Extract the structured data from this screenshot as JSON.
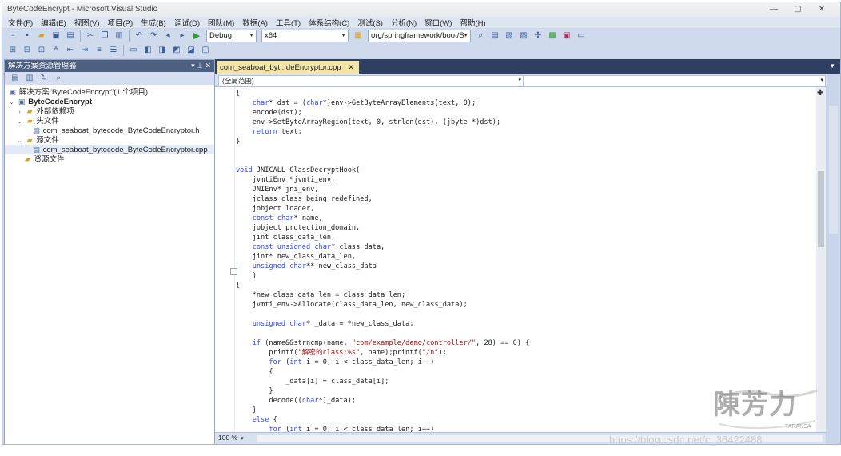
{
  "window": {
    "title": "ByteCodeEncrypt - Microsoft Visual Studio",
    "buttons": [
      "—",
      "▢",
      "✕"
    ]
  },
  "menu": [
    "文件(F)",
    "编辑(E)",
    "视图(V)",
    "项目(P)",
    "生成(B)",
    "调试(D)",
    "团队(M)",
    "数据(A)",
    "工具(T)",
    "体系结构(C)",
    "测试(S)",
    "分析(N)",
    "窗口(W)",
    "帮助(H)"
  ],
  "toolbar": {
    "config": "Debug",
    "platform": "x64",
    "find": "org/springframework/boot/S"
  },
  "solution_explorer": {
    "title": "解决方案资源管理器",
    "controls": "▾ ⊥ ✕",
    "items": [
      {
        "label": "解决方案\"ByteCodeEncrypt\"(1 个项目)",
        "icon": "solution-icon"
      },
      {
        "label": "ByteCodeEncrypt",
        "icon": "project-icon",
        "expander": "⌄"
      },
      {
        "label": "外部依赖项",
        "icon": "folder-icon",
        "expander": "›"
      },
      {
        "label": "头文件",
        "icon": "folder-icon",
        "expander": "⌄"
      },
      {
        "label": "com_seaboat_bytecode_ByteCodeEncryptor.h",
        "icon": "header-file-icon"
      },
      {
        "label": "源文件",
        "icon": "folder-icon",
        "expander": "⌄"
      },
      {
        "label": "com_seaboat_bytecode_ByteCodeEncryptor.cpp",
        "icon": "cpp-file-icon"
      },
      {
        "label": "资源文件",
        "icon": "folder-icon"
      }
    ]
  },
  "editor": {
    "tab": "com_seaboat_byt...deEncryptor.cpp",
    "tab_close": "✕",
    "scope": "(全局范围)",
    "zoom": "100 %",
    "code": [
      [
        [
          "",
          "{"
        ]
      ],
      [
        [
          "",
          "    "
        ],
        [
          "kw",
          "char"
        ],
        [
          "",
          "* dst = ("
        ],
        [
          "kw",
          "char"
        ],
        [
          "",
          "*)env->GetByteArrayElements(text, 0);"
        ]
      ],
      [
        [
          "",
          "    encode(dst);"
        ]
      ],
      [
        [
          "",
          "    env->SetByteArrayRegion(text, 0, strlen(dst), (jbyte *)dst);"
        ]
      ],
      [
        [
          "",
          "    "
        ],
        [
          "kw",
          "return"
        ],
        [
          "",
          " text;"
        ]
      ],
      [
        [
          "",
          "}"
        ]
      ],
      [
        [
          "",
          ""
        ]
      ],
      [
        [
          "",
          ""
        ]
      ],
      [
        [
          "kw",
          "void"
        ],
        [
          "",
          " JNICALL ClassDecryptHook("
        ]
      ],
      [
        [
          "",
          "    jvmtiEnv *jvmti_env,"
        ]
      ],
      [
        [
          "",
          "    JNIEnv* jni_env,"
        ]
      ],
      [
        [
          "",
          "    jclass class_being_redefined,"
        ]
      ],
      [
        [
          "",
          "    jobject loader,"
        ]
      ],
      [
        [
          "",
          "    "
        ],
        [
          "kw",
          "const"
        ],
        [
          "",
          " "
        ],
        [
          "kw",
          "char"
        ],
        [
          "",
          "* name,"
        ]
      ],
      [
        [
          "",
          "    jobject protection_domain,"
        ]
      ],
      [
        [
          "",
          "    jint class_data_len,"
        ]
      ],
      [
        [
          "",
          "    "
        ],
        [
          "kw",
          "const"
        ],
        [
          "",
          " "
        ],
        [
          "kw",
          "unsigned"
        ],
        [
          "",
          " "
        ],
        [
          "kw",
          "char"
        ],
        [
          "",
          "* class_data,"
        ]
      ],
      [
        [
          "",
          "    jint* new_class_data_len,"
        ]
      ],
      [
        [
          "",
          "    "
        ],
        [
          "kw",
          "unsigned"
        ],
        [
          "",
          " "
        ],
        [
          "kw",
          "char"
        ],
        [
          "",
          "** new_class_data"
        ]
      ],
      [
        [
          "",
          "    )"
        ]
      ],
      [
        [
          "",
          "{"
        ]
      ],
      [
        [
          "",
          "    *new_class_data_len = class_data_len;"
        ]
      ],
      [
        [
          "",
          "    jvmti_env->Allocate(class_data_len, new_class_data);"
        ]
      ],
      [
        [
          "",
          ""
        ]
      ],
      [
        [
          "",
          "    "
        ],
        [
          "kw",
          "unsigned"
        ],
        [
          "",
          " "
        ],
        [
          "kw",
          "char"
        ],
        [
          "",
          "* _data = *new_class_data;"
        ]
      ],
      [
        [
          "",
          ""
        ]
      ],
      [
        [
          "",
          "    "
        ],
        [
          "kw",
          "if"
        ],
        [
          "",
          " (name&&strncmp(name, "
        ],
        [
          "str",
          "\"com/example/demo/controller/\""
        ],
        [
          "",
          ", 28) == 0) {"
        ]
      ],
      [
        [
          "",
          "        printf("
        ],
        [
          "str",
          "\"解密的class:%s\""
        ],
        [
          "",
          ", name);printf("
        ],
        [
          "str",
          "\"/n\""
        ],
        [
          "",
          ");"
        ]
      ],
      [
        [
          "",
          "        "
        ],
        [
          "kw",
          "for"
        ],
        [
          "",
          " ("
        ],
        [
          "kw",
          "int"
        ],
        [
          "",
          " i = 0; i < class_data_len; i++)"
        ]
      ],
      [
        [
          "",
          "        {"
        ]
      ],
      [
        [
          "",
          "            _data[i] = class_data[i];"
        ]
      ],
      [
        [
          "",
          "        }"
        ]
      ],
      [
        [
          "",
          "        decode(("
        ],
        [
          "kw",
          "char"
        ],
        [
          "",
          "*)_data);"
        ]
      ],
      [
        [
          "",
          "    }"
        ]
      ],
      [
        [
          "",
          "    "
        ],
        [
          "kw",
          "else"
        ],
        [
          "",
          " {"
        ]
      ],
      [
        [
          "",
          "        "
        ],
        [
          "kw",
          "for"
        ],
        [
          "",
          " ("
        ],
        [
          "kw",
          "int"
        ],
        [
          "",
          " i = 0; i < class_data_len; i++)"
        ]
      ],
      [
        [
          "",
          "        {"
        ]
      ]
    ]
  },
  "watermark": {
    "logo": "陳芳力",
    "logo_sub": "TARANSA",
    "url": "https://blog.csdn.net/c_36422488"
  },
  "colors": {
    "keyword": "#2b4cff",
    "string": "#a31515",
    "doc_tab": "#f3e4a8",
    "panel_header": "#4d6082"
  }
}
